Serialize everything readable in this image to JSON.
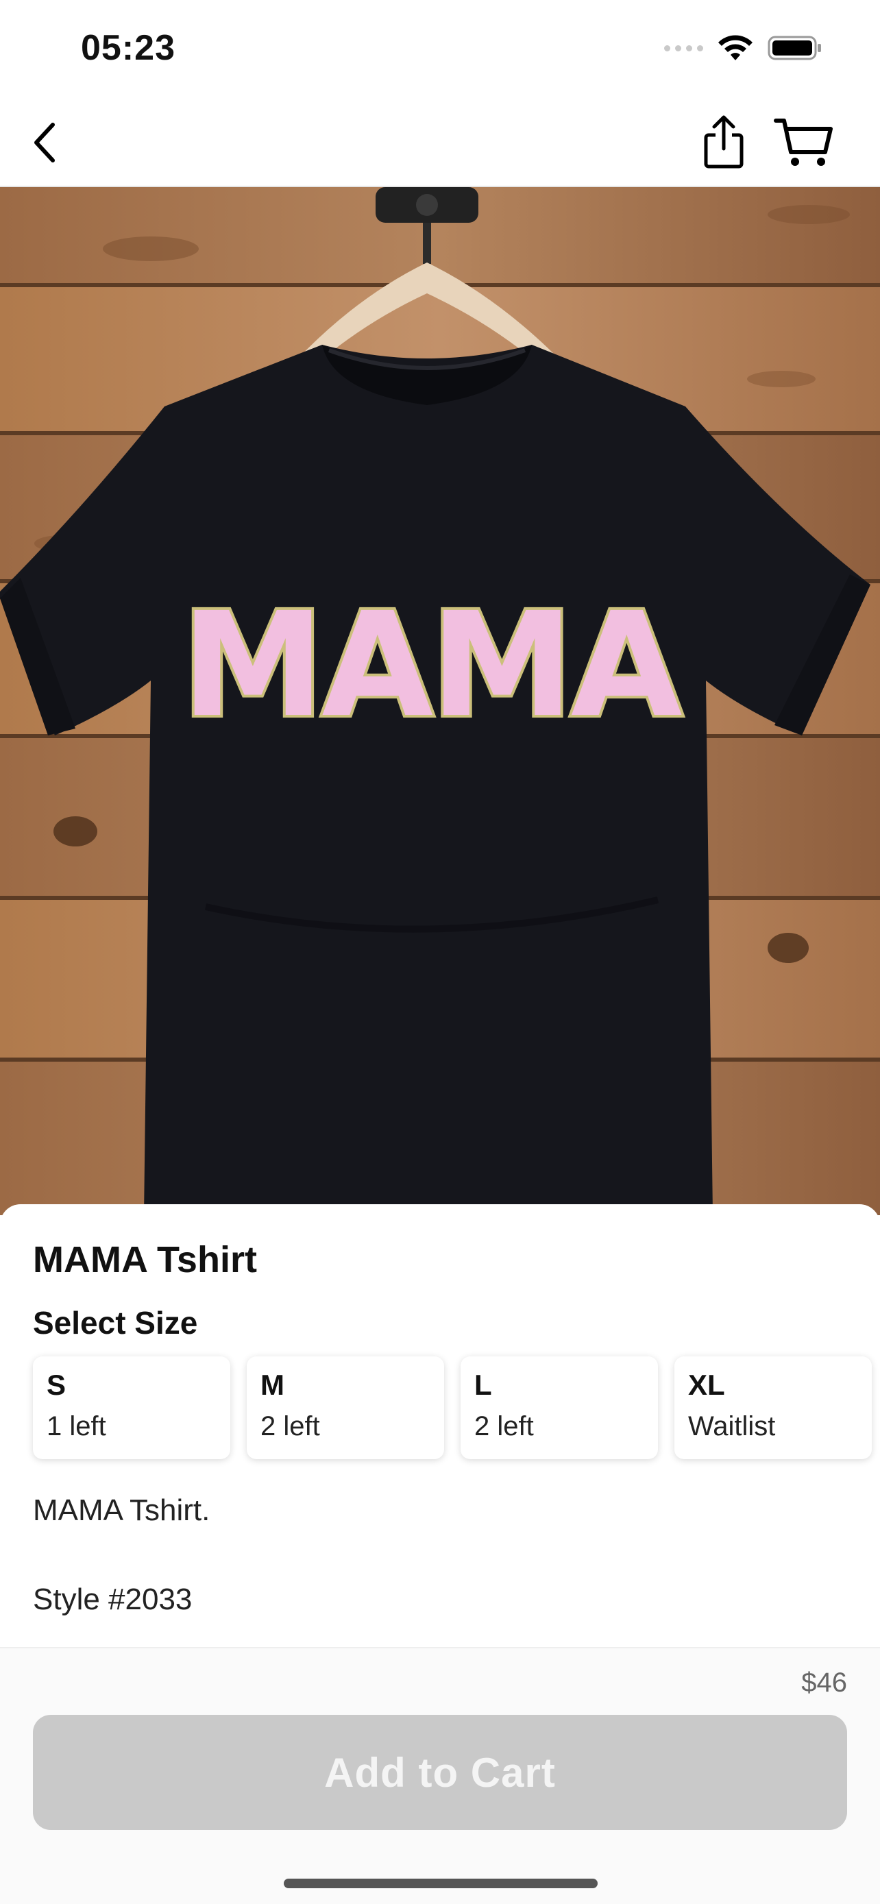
{
  "status_bar": {
    "time": "05:23",
    "icons": [
      "cellular-signal-icon",
      "wifi-icon",
      "battery-icon"
    ]
  },
  "nav": {
    "icons": [
      "back-arrow-icon",
      "share-icon",
      "cart-icon"
    ]
  },
  "product": {
    "image_icon": "product-photo",
    "graphic_text": "MAMA",
    "title": "MAMA Tshirt",
    "select_size_label": "Select Size",
    "sizes": [
      {
        "label": "S",
        "stock": "1 left"
      },
      {
        "label": "M",
        "stock": "2 left"
      },
      {
        "label": "L",
        "stock": "2 left"
      },
      {
        "label": "XL",
        "stock": "Waitlist"
      }
    ],
    "description": "MAMA Tshirt.",
    "style": "Style #2033"
  },
  "footer": {
    "price": "$46",
    "add_to_cart_label": "Add to Cart"
  },
  "colors": {
    "button_disabled": "#c9c9c9",
    "shirt": "#15161c",
    "patch_pink": "#f2bfe0",
    "wood": "#a9774f"
  }
}
